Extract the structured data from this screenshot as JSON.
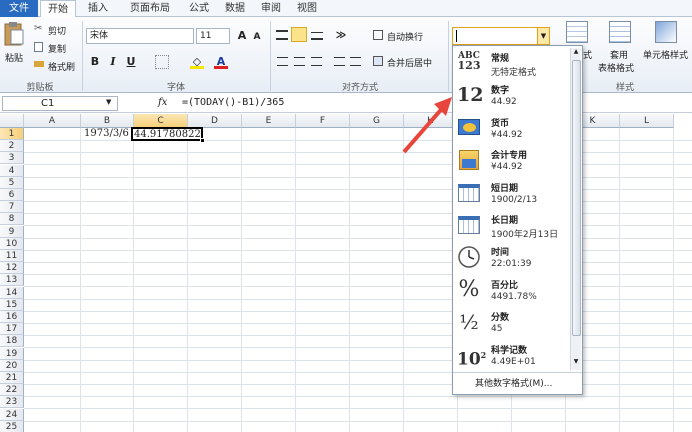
{
  "tabs": [
    "文件",
    "开始",
    "插入",
    "页面布局",
    "公式",
    "数据",
    "审阅",
    "视图"
  ],
  "clipboard": {
    "paste": "粘贴",
    "cut": "剪切",
    "copy": "复制",
    "format_painter": "格式刷",
    "label": "剪贴板"
  },
  "font": {
    "name": "宋体",
    "size": "11",
    "label": "字体"
  },
  "alignment": {
    "wrap": "自动换行",
    "merge": "合并后居中",
    "label": "对齐方式"
  },
  "styles": {
    "cond": "条件格式",
    "table": "套用表格格式",
    "table1": "套用",
    "table2": "表格格式",
    "cell": "单元格样式",
    "label": "样式",
    "partial": "式"
  },
  "formula_bar": {
    "cell_ref": "C1",
    "fx": "fx",
    "formula": "=(TODAY()-B1)/365"
  },
  "columns": [
    "A",
    "B",
    "C",
    "D",
    "E",
    "F",
    "G",
    "H",
    "I",
    "J",
    "K",
    "L"
  ],
  "rows": [
    "1",
    "2",
    "3",
    "4",
    "5",
    "6",
    "7",
    "8",
    "9",
    "10",
    "11",
    "12",
    "13",
    "14",
    "15",
    "16",
    "17",
    "18",
    "19",
    "20",
    "21",
    "22",
    "23",
    "24",
    "25"
  ],
  "cells": {
    "B1": "1973/3/6",
    "C1": "44.91780822"
  },
  "number_format_menu": {
    "items": [
      {
        "title": "常规",
        "value": "无特定格式",
        "icon": "abc-123-icon"
      },
      {
        "title": "数字",
        "value": "44.92",
        "icon": "number-12-icon"
      },
      {
        "title": "货币",
        "value": "¥44.92",
        "icon": "currency-icon"
      },
      {
        "title": "会计专用",
        "value": " ¥44.92",
        "icon": "accounting-icon"
      },
      {
        "title": "短日期",
        "value": "1900/2/13",
        "icon": "short-date-icon"
      },
      {
        "title": "长日期",
        "value": "1900年2月13日",
        "icon": "long-date-icon"
      },
      {
        "title": "时间",
        "value": "22:01:39",
        "icon": "clock-icon"
      },
      {
        "title": "百分比",
        "value": "4491.78%",
        "icon": "percent-icon"
      },
      {
        "title": "分数",
        "value": "45",
        "icon": "fraction-icon"
      },
      {
        "title": "科学记数",
        "value": "4.49E+01",
        "icon": "scientific-icon"
      }
    ],
    "more": "其他数字格式(M)..."
  },
  "colors": {
    "accent": "#2a6bc2",
    "selection": "#217346",
    "arrow": "#e8453c"
  }
}
